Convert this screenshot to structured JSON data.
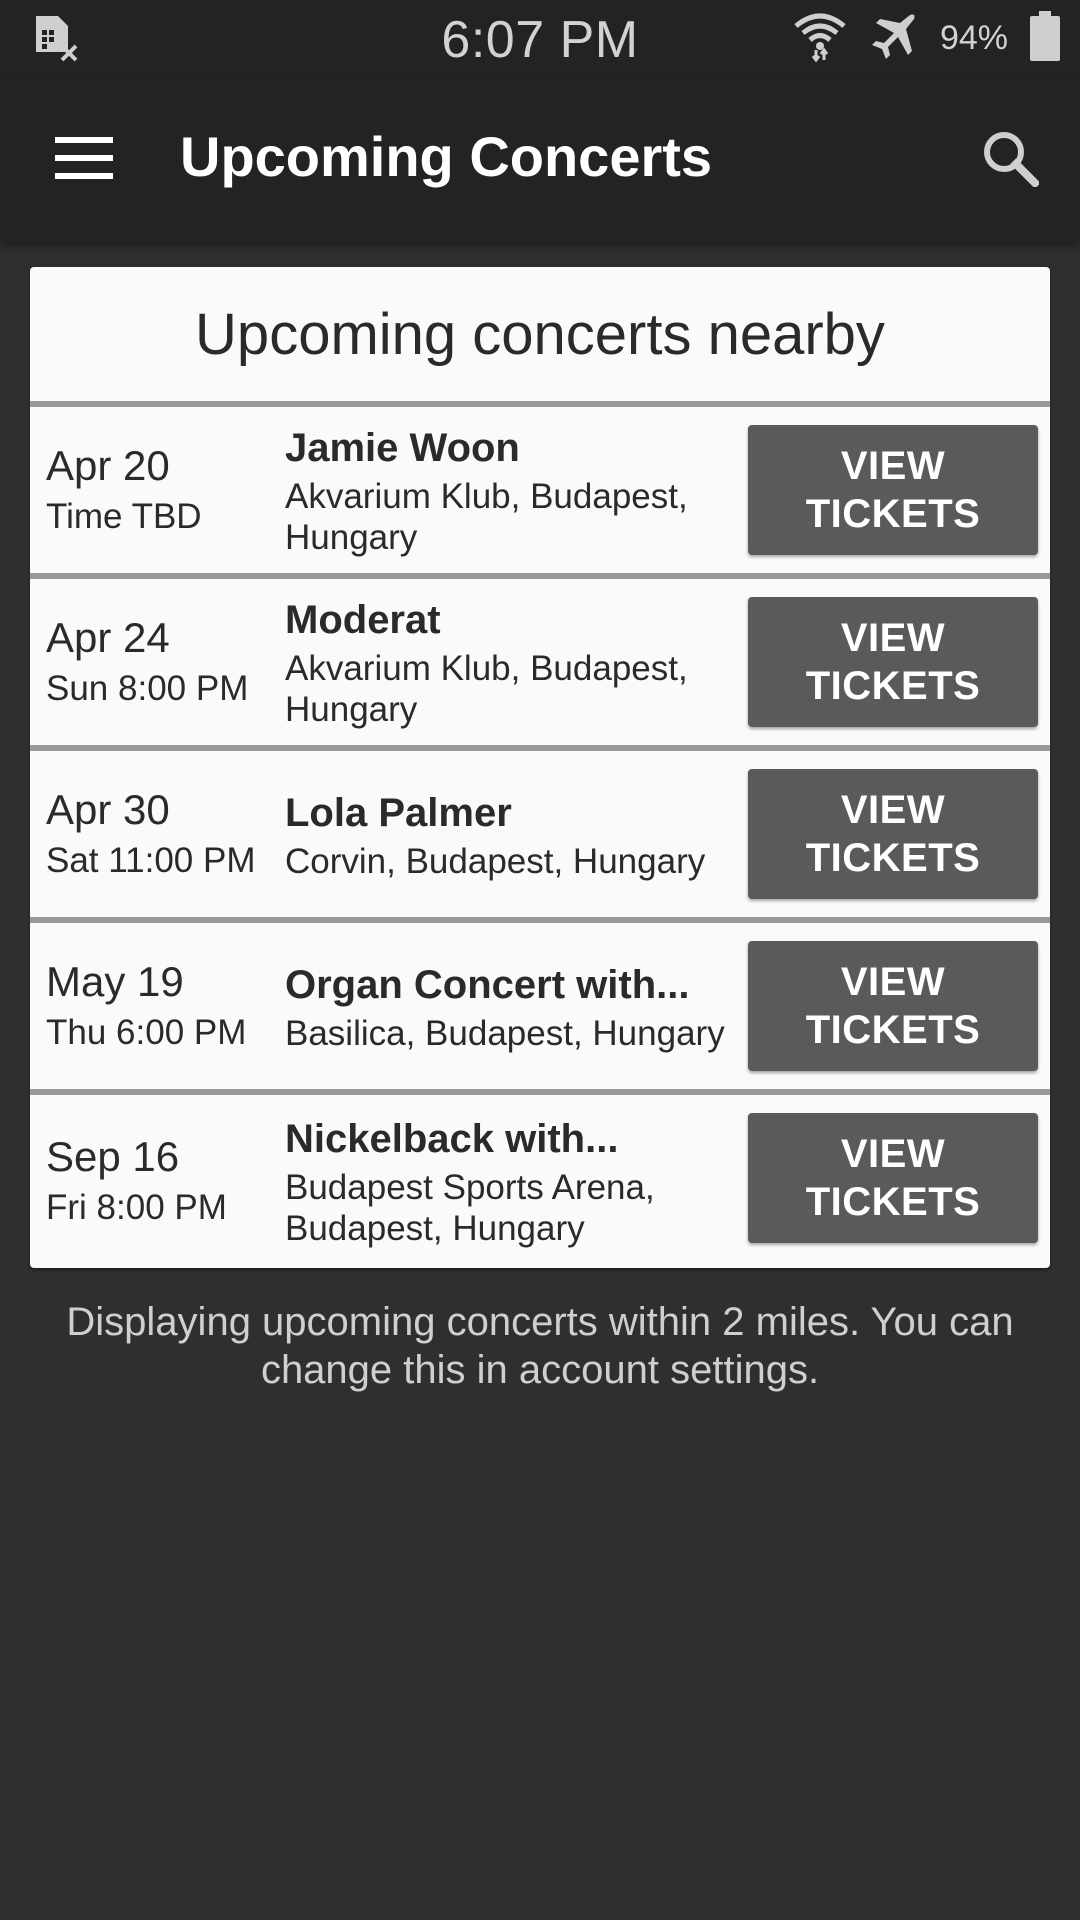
{
  "status_bar": {
    "time": "6:07 PM",
    "battery": "94%",
    "icons": [
      "no-sim-icon",
      "wifi-icon",
      "airplane-icon",
      "battery-icon"
    ]
  },
  "app_bar": {
    "title": "Upcoming Concerts",
    "menu_icon": "menu-icon",
    "search_icon": "search-icon"
  },
  "card": {
    "header": "Upcoming concerts nearby",
    "concerts": [
      {
        "date": "Apr 20",
        "time": "Time TBD",
        "artist": "Jamie Woon",
        "venue": "Akvarium Klub, Budapest, Hungary",
        "button": "VIEW\nTICKETS"
      },
      {
        "date": "Apr 24",
        "time": "Sun 8:00 PM",
        "artist": "Moderat",
        "venue": "Akvarium Klub, Budapest, Hungary",
        "button": "VIEW\nTICKETS"
      },
      {
        "date": "Apr 30",
        "time": "Sat 11:00 PM",
        "artist": "Lola Palmer",
        "venue": "Corvin, Budapest, Hungary",
        "button": "VIEW\nTICKETS"
      },
      {
        "date": "May 19",
        "time": "Thu 6:00 PM",
        "artist": "Organ Concert with...",
        "venue": "Basilica, Budapest, Hungary",
        "button": "VIEW\nTICKETS"
      },
      {
        "date": "Sep 16",
        "time": "Fri 8:00 PM",
        "artist": "Nickelback with...",
        "venue": "Budapest Sports Arena, Budapest, Hungary",
        "button": "VIEW\nTICKETS"
      }
    ]
  },
  "footer": {
    "note": "Displaying upcoming concerts within 2 miles.  You can change this in account settings."
  },
  "colors": {
    "app_bar": "#232323",
    "background": "#2f2f2f",
    "card": "#fafafa",
    "button": "#5a5a5c",
    "divider": "#9a9a9a"
  }
}
